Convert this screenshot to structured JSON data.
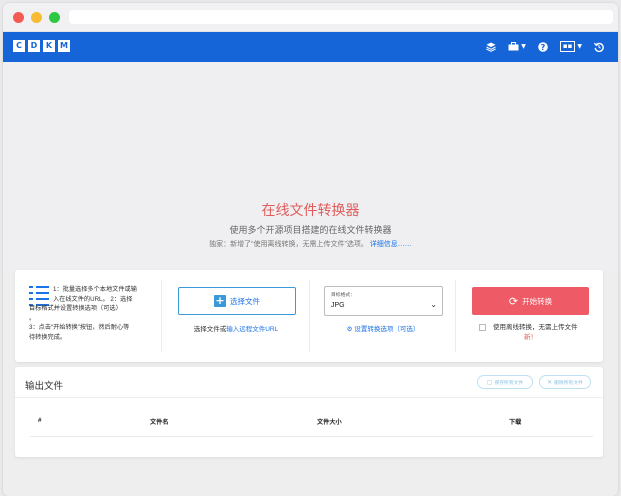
{
  "navbar": {
    "logo_letters": [
      "C",
      "D",
      "K",
      "M"
    ],
    "icons": [
      {
        "name": "layers-icon",
        "glyph": "≋",
        "caret": false
      },
      {
        "name": "toolbox-icon",
        "glyph": "▰",
        "caret": true
      },
      {
        "name": "help-icon",
        "glyph": "?",
        "caret": false
      },
      {
        "name": "language-icon",
        "glyph": "CC",
        "caret": true
      },
      {
        "name": "history-icon",
        "glyph": "↺",
        "caret": false
      }
    ]
  },
  "hero": {
    "title": "在线文件转换器",
    "subtitle": "使用多个开源项目搭建的在线文件转换器",
    "note_text": "独家：新增了“使用离线转换，无需上传文件”选项。",
    "note_link": "详细信息……"
  },
  "steps": {
    "line1": "1：批量选择多个本地文件或输",
    "line2": "入在线文件的URL。 2：选择",
    "line3": "目标格式并设置转换选项（可选）",
    "line4": "。",
    "line5": "3：点击“开始转换”按钮，然后耐心等",
    "line6": "待转换完成。"
  },
  "choose": {
    "button_label": "选择文件",
    "hint_text": "选择文件或",
    "hint_link": "输入远程文件URL"
  },
  "format": {
    "label": "目标格式：",
    "value": "JPG",
    "options_link": "设置转换选项（可选）"
  },
  "start": {
    "button_label": "开始转换",
    "offline_text": "使用离线转换，无需上传文件",
    "offline_new": "新！"
  },
  "output": {
    "title": "输出文件",
    "save_all": "保存所有文件",
    "delete_all": "删除所有文件",
    "columns": [
      "#",
      "文件名",
      "文件大小",
      "下载"
    ]
  },
  "colors": {
    "brand_blue": "#1565d8",
    "accent_red": "#ee5a66",
    "link_blue": "#1a73e8"
  }
}
